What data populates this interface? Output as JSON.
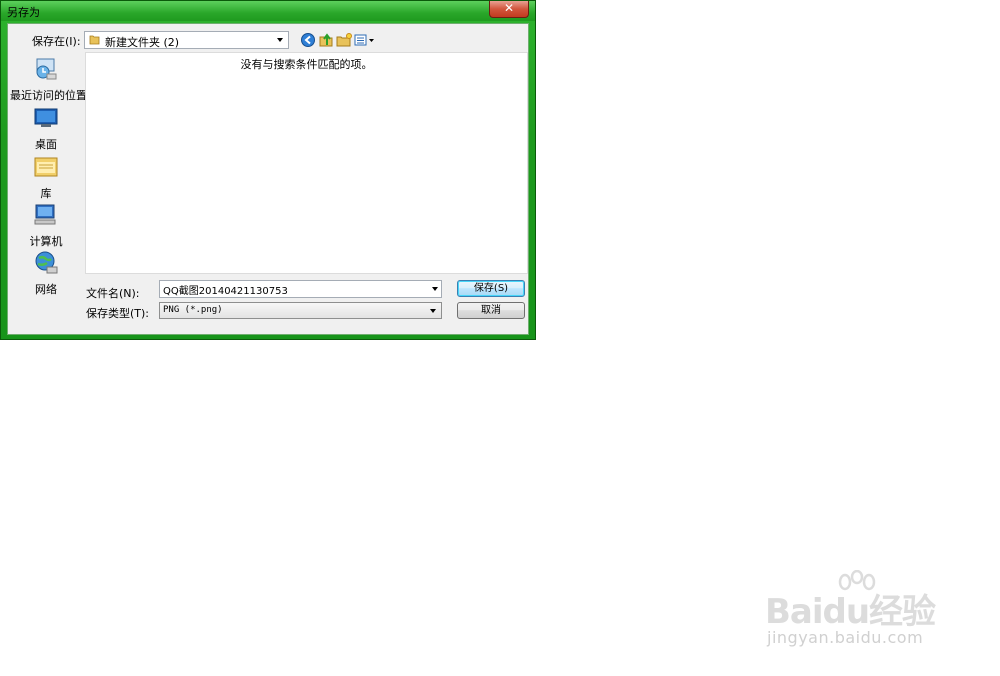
{
  "window": {
    "title": "另存为",
    "close_symbol": "✕"
  },
  "location": {
    "label": "保存在(I):",
    "current_folder": "新建文件夹 (2)"
  },
  "toolbar": {
    "icons": [
      "back-icon",
      "up-folder-icon",
      "new-folder-icon",
      "view-menu-icon"
    ]
  },
  "sidebar": {
    "items": [
      {
        "label": "最近访问的位置",
        "icon": "recent-places-icon"
      },
      {
        "label": "桌面",
        "icon": "desktop-icon"
      },
      {
        "label": "库",
        "icon": "libraries-icon"
      },
      {
        "label": "计算机",
        "icon": "computer-icon"
      },
      {
        "label": "网络",
        "icon": "network-icon"
      }
    ]
  },
  "file_list": {
    "empty_message": "没有与搜索条件匹配的项。"
  },
  "form": {
    "filename_label": "文件名(N):",
    "filename_value": "QQ截图20140421130753",
    "filetype_label": "保存类型(T):",
    "filetype_value": "PNG (*.png)"
  },
  "buttons": {
    "save": "保存(S)",
    "cancel": "取消"
  },
  "watermark": {
    "brand": "Baidu经验",
    "url": "jingyan.baidu.com"
  },
  "colors": {
    "frame": "#1f9a1f",
    "title_highlight": "#5dd05d",
    "close_button": "#c23a1f"
  }
}
